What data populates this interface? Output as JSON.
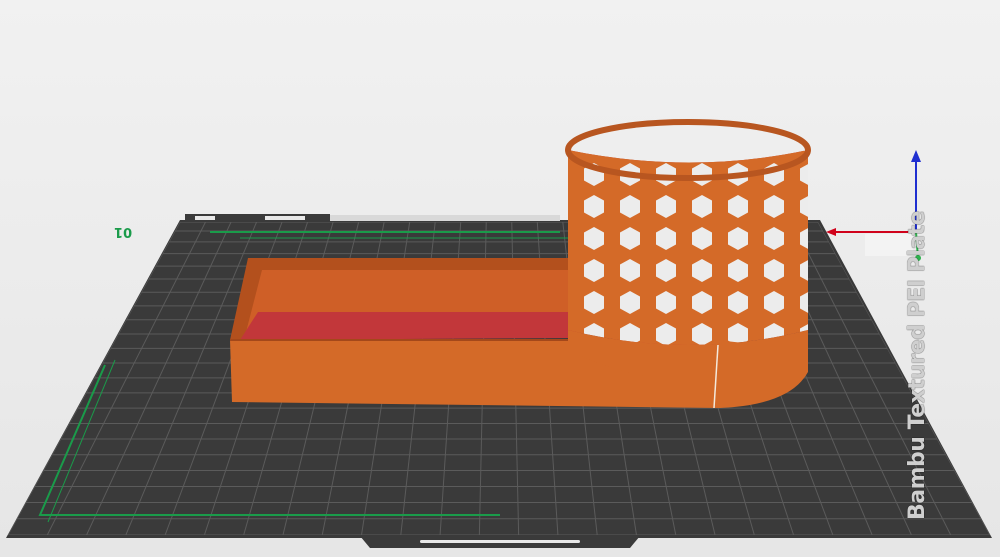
{
  "viewport": {
    "plate_name": "Bambu Textured PEI Plate",
    "plate_number": "01"
  },
  "colors": {
    "background": "#ececec",
    "plate": "#3a3a3a",
    "grid": "#5a5a5a",
    "model": "#d46a28",
    "model_dark": "#a4481a",
    "bridge_red": "#c2373a",
    "axis_x": "#d0021b",
    "axis_y": "#2db14d",
    "axis_z": "#1f2fd0",
    "green_edge": "#1a9b4a"
  },
  "icons": [
    "x-axis-arrow-icon",
    "y-axis-arrow-icon",
    "z-axis-arrow-icon"
  ]
}
